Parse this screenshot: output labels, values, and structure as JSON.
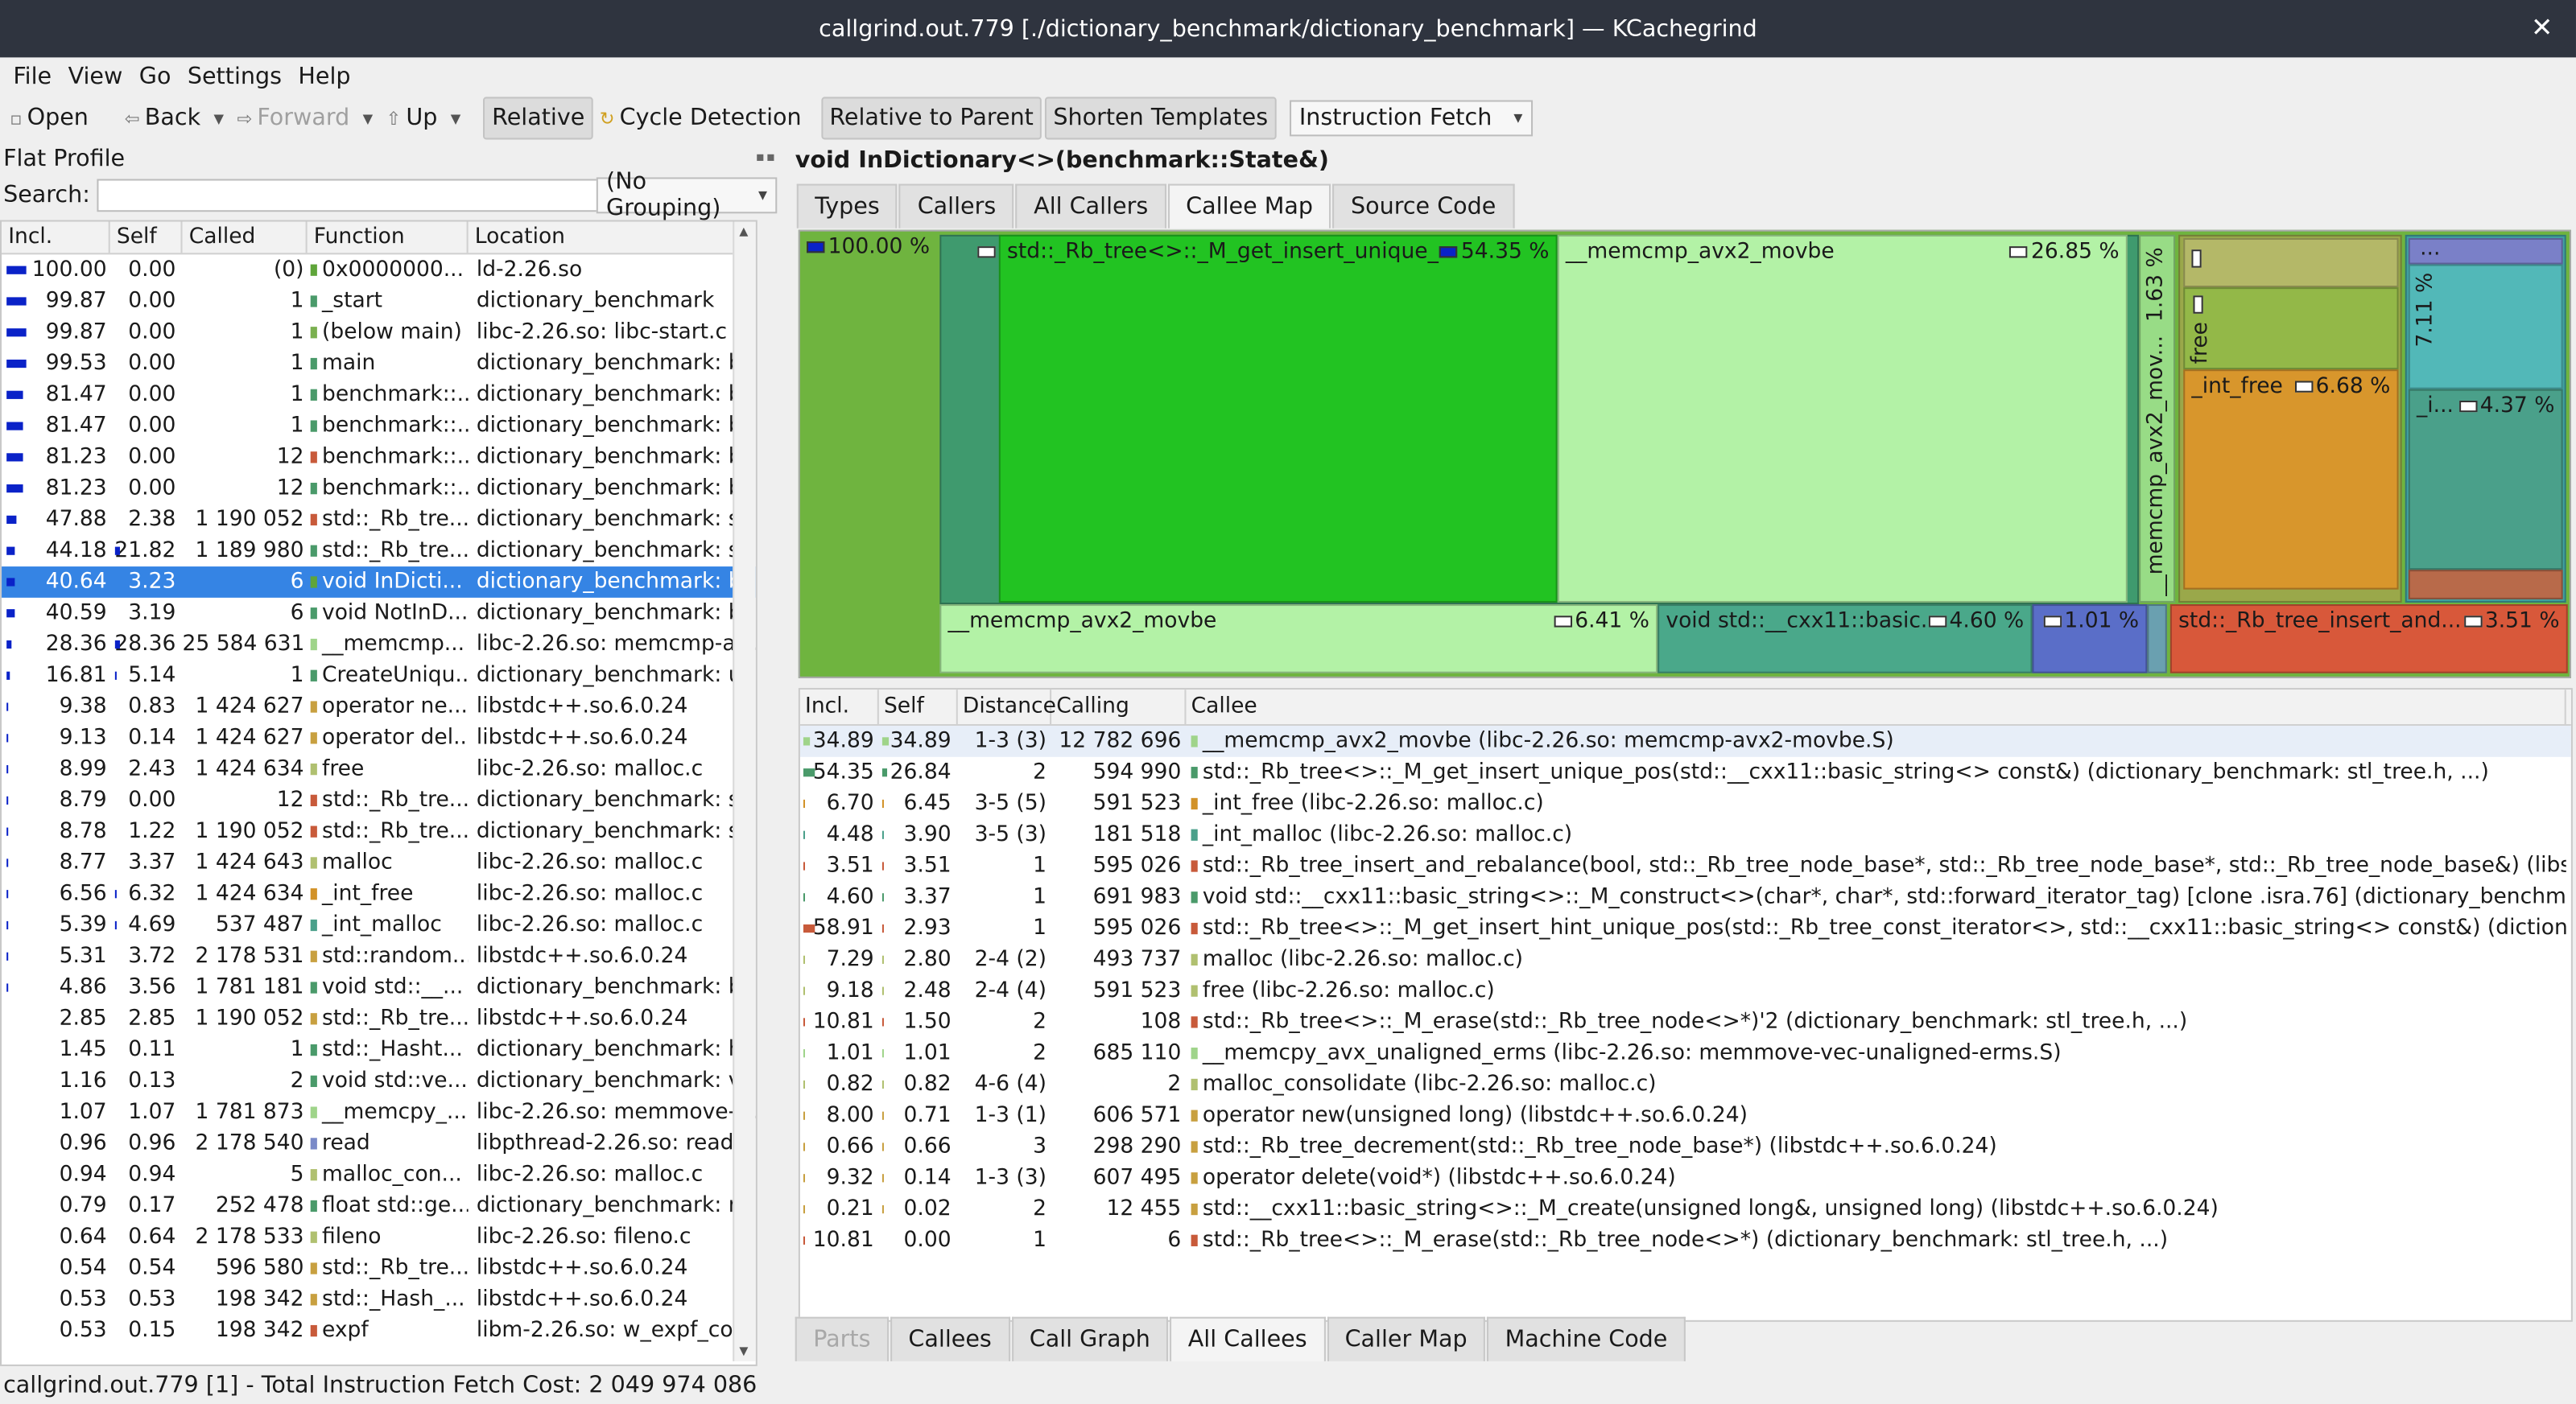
{
  "window": {
    "title": "callgrind.out.779 [./dictionary_benchmark/dictionary_benchmark] — KCachegrind",
    "close": "✕"
  },
  "menu": [
    "File",
    "View",
    "Go",
    "Settings",
    "Help"
  ],
  "toolbar": {
    "open": "Open",
    "back": "Back",
    "forward": "Forward",
    "up": "Up",
    "relative": "Relative",
    "cycle": "Cycle Detection",
    "relative_parent": "Relative to Parent",
    "shorten": "Shorten Templates",
    "event": "Instruction Fetch"
  },
  "flat_profile": {
    "title": "Flat Profile",
    "search_label": "Search:",
    "search_value": "",
    "grouping": "(No Grouping)",
    "columns": [
      "Incl.",
      "Self",
      "Called",
      "Function",
      "Location"
    ],
    "rows": [
      {
        "incl": "100.00",
        "self": "0.00",
        "called": "(0)",
        "func": "0x0000000...",
        "loc": "ld-2.26.so",
        "ibar": 1.0,
        "sbar": 0,
        "sw": "#5fa53a"
      },
      {
        "incl": "99.87",
        "self": "0.00",
        "called": "1",
        "func": "_start",
        "loc": "dictionary_benchmark",
        "ibar": 0.9987,
        "sbar": 0,
        "sw": "#4a9a6a"
      },
      {
        "incl": "99.87",
        "self": "0.00",
        "called": "1",
        "func": "(below main)",
        "loc": "libc-2.26.so: libc-start.c",
        "ibar": 0.9987,
        "sbar": 0,
        "sw": "#7ab04f"
      },
      {
        "incl": "99.53",
        "self": "0.00",
        "called": "1",
        "func": "main",
        "loc": "dictionary_benchmark: be...",
        "ibar": 0.9953,
        "sbar": 0,
        "sw": "#4a9a6a"
      },
      {
        "incl": "81.47",
        "self": "0.00",
        "called": "1",
        "func": "benchmark::...",
        "loc": "dictionary_benchmark: be...",
        "ibar": 0.8147,
        "sbar": 0,
        "sw": "#4a9a6a"
      },
      {
        "incl": "81.47",
        "self": "0.00",
        "called": "1",
        "func": "benchmark::...",
        "loc": "dictionary_benchmark: be...",
        "ibar": 0.8147,
        "sbar": 0,
        "sw": "#4a9a6a"
      },
      {
        "incl": "81.23",
        "self": "0.00",
        "called": "12",
        "func": "benchmark::...",
        "loc": "dictionary_benchmark: be...",
        "ibar": 0.8123,
        "sbar": 0,
        "sw": "#c85a3a"
      },
      {
        "incl": "81.23",
        "self": "0.00",
        "called": "12",
        "func": "benchmark::...",
        "loc": "dictionary_benchmark: be...",
        "ibar": 0.8123,
        "sbar": 0,
        "sw": "#4a9a6a"
      },
      {
        "incl": "47.88",
        "self": "2.38",
        "called": "1 190 052",
        "func": "std::_Rb_tre...",
        "loc": "dictionary_benchmark: stl...",
        "ibar": 0.4788,
        "sbar": 0.0238,
        "sw": "#c85a3a"
      },
      {
        "incl": "44.18",
        "self": "21.82",
        "called": "1 189 980",
        "func": "std::_Rb_tre...",
        "loc": "dictionary_benchmark: stl...",
        "ibar": 0.4418,
        "sbar": 0.2182,
        "sw": "#4a9a6a"
      },
      {
        "incl": "40.64",
        "self": "3.23",
        "called": "6",
        "func": "void InDicti...",
        "loc": "dictionary_benchmark: be...",
        "ibar": 0.4064,
        "sbar": 0.0323,
        "sw": "#5fa53a",
        "sel": true
      },
      {
        "incl": "40.59",
        "self": "3.19",
        "called": "6",
        "func": "void NotInD...",
        "loc": "dictionary_benchmark: be...",
        "ibar": 0.4059,
        "sbar": 0.0319,
        "sw": "#4a9a6a"
      },
      {
        "incl": "28.36",
        "self": "28.36",
        "called": "25 584 631",
        "func": "__memcmp...",
        "loc": "libc-2.26.so: memcmp-av...",
        "ibar": 0.2836,
        "sbar": 0.2836,
        "sw": "#9fd48a"
      },
      {
        "incl": "16.81",
        "self": "5.14",
        "called": "1",
        "func": "CreateUniqu...",
        "loc": "dictionary_benchmark: uti...",
        "ibar": 0.1681,
        "sbar": 0.0514,
        "sw": "#4a9a6a"
      },
      {
        "incl": "9.38",
        "self": "0.83",
        "called": "1 424 627",
        "func": "operator ne...",
        "loc": "libstdc++.so.6.0.24",
        "ibar": 0.0938,
        "sbar": 0.0083,
        "sw": "#c8a040"
      },
      {
        "incl": "9.13",
        "self": "0.14",
        "called": "1 424 627",
        "func": "operator del...",
        "loc": "libstdc++.so.6.0.24",
        "ibar": 0.0913,
        "sbar": 0.0014,
        "sw": "#c8a040"
      },
      {
        "incl": "8.99",
        "self": "2.43",
        "called": "1 424 634",
        "func": "free",
        "loc": "libc-2.26.so: malloc.c",
        "ibar": 0.0899,
        "sbar": 0.0243,
        "sw": "#b0c070"
      },
      {
        "incl": "8.79",
        "self": "0.00",
        "called": "12",
        "func": "std::_Rb_tre...",
        "loc": "dictionary_benchmark: stl...",
        "ibar": 0.0879,
        "sbar": 0,
        "sw": "#c85a3a"
      },
      {
        "incl": "8.78",
        "self": "1.22",
        "called": "1 190 052",
        "func": "std::_Rb_tre...",
        "loc": "dictionary_benchmark: stl...",
        "ibar": 0.0878,
        "sbar": 0.0122,
        "sw": "#c85a3a"
      },
      {
        "incl": "8.77",
        "self": "3.37",
        "called": "1 424 643",
        "func": "malloc",
        "loc": "libc-2.26.so: malloc.c",
        "ibar": 0.0877,
        "sbar": 0.0337,
        "sw": "#b0c070"
      },
      {
        "incl": "6.56",
        "self": "6.32",
        "called": "1 424 634",
        "func": "_int_free",
        "loc": "libc-2.26.so: malloc.c",
        "ibar": 0.0656,
        "sbar": 0.0632,
        "sw": "#d29228"
      },
      {
        "incl": "5.39",
        "self": "4.69",
        "called": "537 487",
        "func": "_int_malloc",
        "loc": "libc-2.26.so: malloc.c",
        "ibar": 0.0539,
        "sbar": 0.0469,
        "sw": "#4aa08a"
      },
      {
        "incl": "5.31",
        "self": "3.72",
        "called": "2 178 531",
        "func": "std::random...",
        "loc": "libstdc++.so.6.0.24",
        "ibar": 0.0531,
        "sbar": 0.0372,
        "sw": "#c8a040"
      },
      {
        "incl": "4.86",
        "self": "3.56",
        "called": "1 781 181",
        "func": "void std::__...",
        "loc": "dictionary_benchmark: ba...",
        "ibar": 0.0486,
        "sbar": 0.0356,
        "sw": "#4a9a6a"
      },
      {
        "incl": "2.85",
        "self": "2.85",
        "called": "1 190 052",
        "func": "std::_Rb_tre...",
        "loc": "libstdc++.so.6.0.24",
        "ibar": 0.0285,
        "sbar": 0.0285,
        "sw": "#c8a040"
      },
      {
        "incl": "1.45",
        "self": "0.11",
        "called": "1",
        "func": "std::_Hasht...",
        "loc": "dictionary_benchmark: ha...",
        "ibar": 0.0145,
        "sbar": 0.0011,
        "sw": "#4a9a6a"
      },
      {
        "incl": "1.16",
        "self": "0.13",
        "called": "2",
        "func": "void std::ve...",
        "loc": "dictionary_benchmark: ve...",
        "ibar": 0.0116,
        "sbar": 0.0013,
        "sw": "#4a9a6a"
      },
      {
        "incl": "1.07",
        "self": "1.07",
        "called": "1 781 873",
        "func": "__memcpy_...",
        "loc": "libc-2.26.so: memmove-v...",
        "ibar": 0.0107,
        "sbar": 0.0107,
        "sw": "#9fd48a"
      },
      {
        "incl": "0.96",
        "self": "0.96",
        "called": "2 178 540",
        "func": "read",
        "loc": "libpthread-2.26.so: read.c",
        "ibar": 0.0096,
        "sbar": 0.0096,
        "sw": "#7a8ac8"
      },
      {
        "incl": "0.94",
        "self": "0.94",
        "called": "5",
        "func": "malloc_con...",
        "loc": "libc-2.26.so: malloc.c",
        "ibar": 0.0094,
        "sbar": 0.0094,
        "sw": "#b0c070"
      },
      {
        "incl": "0.79",
        "self": "0.17",
        "called": "252 478",
        "func": "float std::ge...",
        "loc": "dictionary_benchmark: ra...",
        "ibar": 0.0079,
        "sbar": 0.0017,
        "sw": "#4a9a6a"
      },
      {
        "incl": "0.64",
        "self": "0.64",
        "called": "2 178 533",
        "func": "fileno",
        "loc": "libc-2.26.so: fileno.c",
        "ibar": 0.0064,
        "sbar": 0.0064,
        "sw": "#b0c070"
      },
      {
        "incl": "0.54",
        "self": "0.54",
        "called": "596 580",
        "func": "std::_Rb_tre...",
        "loc": "libstdc++.so.6.0.24",
        "ibar": 0.0054,
        "sbar": 0.0054,
        "sw": "#c8a040"
      },
      {
        "incl": "0.53",
        "self": "0.53",
        "called": "198 342",
        "func": "std::_Hash_...",
        "loc": "libstdc++.so.6.0.24",
        "ibar": 0.0053,
        "sbar": 0.0053,
        "sw": "#c8a040"
      },
      {
        "incl": "0.53",
        "self": "0.15",
        "called": "198 342",
        "func": "expf",
        "loc": "libm-2.26.so: w_expf_co...",
        "ibar": 0.0053,
        "sbar": 0.0015,
        "sw": "#c85a3a"
      }
    ]
  },
  "detail": {
    "title": "void InDictionary<>(benchmark::State&)",
    "top_tabs": [
      "Types",
      "Callers",
      "All Callers",
      "Callee Map",
      "Source Code"
    ],
    "active_top": "Callee Map",
    "map": {
      "root_pct": "100.00 %",
      "rb_get_insert": "std::_Rb_tree<>::_M_get_insert_unique_...",
      "rb_get_insert_pct": "54.35 %",
      "memcmp1": "__memcmp_avx2_movbe",
      "memcmp1_pct": "26.85 %",
      "memcmp_v": "__memcmp_avx2_mov...",
      "memcmp_v_pct": "1.63 %",
      "free": "free",
      "int_free": "_int_free",
      "int_free_pct": "6.68 %",
      "v711_pct": "7.11 %",
      "dots": "...",
      "i_short": "_i...",
      "i_pct": "4.37 %",
      "memcmp2": "__memcmp_avx2_movbe",
      "memcmp2_pct": "6.41 %",
      "construct": "void std::__cxx11::basic...",
      "construct_pct": "4.60 %",
      "small_pct": "1.01 %",
      "rebalance": "std::_Rb_tree_insert_and...",
      "rebalance_pct": "3.51 %"
    },
    "callee_columns": [
      "Incl.",
      "Self",
      "Distance",
      "Calling",
      "Callee"
    ],
    "callees": [
      {
        "incl": "34.89",
        "self": "34.89",
        "dist": "1-3 (3)",
        "calling": "12 782 696",
        "callee": "__memcmp_avx2_movbe (libc-2.26.so: memcmp-avx2-movbe.S)",
        "ib": 0.3489,
        "sb": 0.3489,
        "sw": "#9fd48a",
        "sel": true
      },
      {
        "incl": "54.35",
        "self": "26.84",
        "dist": "2",
        "calling": "594 990",
        "callee": "std::_Rb_tree<>::_M_get_insert_unique_pos(std::__cxx11::basic_string<> const&) (dictionary_benchmark: stl_tree.h, ...)",
        "ib": 0.5435,
        "sb": 0.2684,
        "sw": "#4a9a6a"
      },
      {
        "incl": "6.70",
        "self": "6.45",
        "dist": "3-5 (5)",
        "calling": "591 523",
        "callee": "_int_free (libc-2.26.so: malloc.c)",
        "ib": 0.067,
        "sb": 0.0645,
        "sw": "#d29228"
      },
      {
        "incl": "4.48",
        "self": "3.90",
        "dist": "3-5 (3)",
        "calling": "181 518",
        "callee": "_int_malloc (libc-2.26.so: malloc.c)",
        "ib": 0.0448,
        "sb": 0.039,
        "sw": "#4aa08a"
      },
      {
        "incl": "3.51",
        "self": "3.51",
        "dist": "1",
        "calling": "595 026",
        "callee": "std::_Rb_tree_insert_and_rebalance(bool, std::_Rb_tree_node_base*, std::_Rb_tree_node_base*, std::_Rb_tree_node_base&) (libs...",
        "ib": 0.0351,
        "sb": 0.0351,
        "sw": "#c85a3a"
      },
      {
        "incl": "4.60",
        "self": "3.37",
        "dist": "1",
        "calling": "691 983",
        "callee": "void std::__cxx11::basic_string<>::_M_construct<>(char*, char*, std::forward_iterator_tag) [clone .isra.76] (dictionary_benchmark: b...",
        "ib": 0.046,
        "sb": 0.0337,
        "sw": "#4a9a6a"
      },
      {
        "incl": "58.91",
        "self": "2.93",
        "dist": "1",
        "calling": "595 026",
        "callee": "std::_Rb_tree<>::_M_get_insert_hint_unique_pos(std::_Rb_tree_const_iterator<>, std::__cxx11::basic_string<> const&) (dictionary_...",
        "ib": 0.5891,
        "sb": 0.0293,
        "sw": "#c85a3a"
      },
      {
        "incl": "7.29",
        "self": "2.80",
        "dist": "2-4 (2)",
        "calling": "493 737",
        "callee": "malloc (libc-2.26.so: malloc.c)",
        "ib": 0.0729,
        "sb": 0.028,
        "sw": "#b0c070"
      },
      {
        "incl": "9.18",
        "self": "2.48",
        "dist": "2-4 (4)",
        "calling": "591 523",
        "callee": "free (libc-2.26.so: malloc.c)",
        "ib": 0.0918,
        "sb": 0.0248,
        "sw": "#b0c070"
      },
      {
        "incl": "10.81",
        "self": "1.50",
        "dist": "2",
        "calling": "108",
        "callee": "std::_Rb_tree<>::_M_erase(std::_Rb_tree_node<>*)'2 (dictionary_benchmark: stl_tree.h, ...)",
        "ib": 0.1081,
        "sb": 0.015,
        "sw": "#c85a3a"
      },
      {
        "incl": "1.01",
        "self": "1.01",
        "dist": "2",
        "calling": "685 110",
        "callee": "__memcpy_avx_unaligned_erms (libc-2.26.so: memmove-vec-unaligned-erms.S)",
        "ib": 0.0101,
        "sb": 0.0101,
        "sw": "#9fd48a"
      },
      {
        "incl": "0.82",
        "self": "0.82",
        "dist": "4-6 (4)",
        "calling": "2",
        "callee": "malloc_consolidate (libc-2.26.so: malloc.c)",
        "ib": 0.0082,
        "sb": 0.0082,
        "sw": "#b0c070"
      },
      {
        "incl": "8.00",
        "self": "0.71",
        "dist": "1-3 (1)",
        "calling": "606 571",
        "callee": "operator new(unsigned long) (libstdc++.so.6.0.24)",
        "ib": 0.08,
        "sb": 0.0071,
        "sw": "#c8a040"
      },
      {
        "incl": "0.66",
        "self": "0.66",
        "dist": "3",
        "calling": "298 290",
        "callee": "std::_Rb_tree_decrement(std::_Rb_tree_node_base*) (libstdc++.so.6.0.24)",
        "ib": 0.0066,
        "sb": 0.0066,
        "sw": "#c8a040"
      },
      {
        "incl": "9.32",
        "self": "0.14",
        "dist": "1-3 (3)",
        "calling": "607 495",
        "callee": "operator delete(void*) (libstdc++.so.6.0.24)",
        "ib": 0.0932,
        "sb": 0.0014,
        "sw": "#c8a040"
      },
      {
        "incl": "0.21",
        "self": "0.02",
        "dist": "2",
        "calling": "12 455",
        "callee": "std::__cxx11::basic_string<>::_M_create(unsigned long&, unsigned long) (libstdc++.so.6.0.24)",
        "ib": 0.0021,
        "sb": 0.0002,
        "sw": "#c8a040"
      },
      {
        "incl": "10.81",
        "self": "0.00",
        "dist": "1",
        "calling": "6",
        "callee": "std::_Rb_tree<>::_M_erase(std::_Rb_tree_node<>*) (dictionary_benchmark: stl_tree.h, ...)",
        "ib": 0.1081,
        "sb": 0,
        "sw": "#c85a3a"
      }
    ],
    "bottom_tabs": [
      "Parts",
      "Callees",
      "Call Graph",
      "All Callees",
      "Caller Map",
      "Machine Code"
    ],
    "active_bottom": "All Callees"
  },
  "status": "callgrind.out.779 [1] - Total Instruction Fetch Cost: 2 049 974 086"
}
